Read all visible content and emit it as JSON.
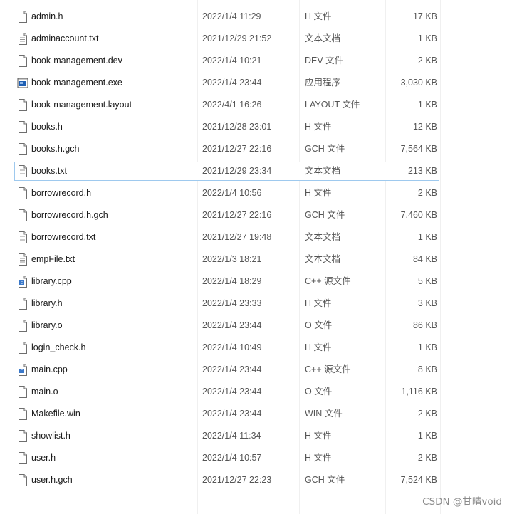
{
  "files": [
    {
      "name": "admin.h",
      "date": "2022/1/4 11:29",
      "type": "H 文件",
      "size": "17 KB",
      "icon": "file-icon"
    },
    {
      "name": "adminaccount.txt",
      "date": "2021/12/29 21:52",
      "type": "文本文档",
      "size": "1 KB",
      "icon": "text-file-icon"
    },
    {
      "name": "book-management.dev",
      "date": "2022/1/4 10:21",
      "type": "DEV 文件",
      "size": "2 KB",
      "icon": "file-icon"
    },
    {
      "name": "book-management.exe",
      "date": "2022/1/4 23:44",
      "type": "应用程序",
      "size": "3,030 KB",
      "icon": "exe-icon"
    },
    {
      "name": "book-management.layout",
      "date": "2022/4/1 16:26",
      "type": "LAYOUT 文件",
      "size": "1 KB",
      "icon": "file-icon"
    },
    {
      "name": "books.h",
      "date": "2021/12/28 23:01",
      "type": "H 文件",
      "size": "12 KB",
      "icon": "file-icon"
    },
    {
      "name": "books.h.gch",
      "date": "2021/12/27 22:16",
      "type": "GCH 文件",
      "size": "7,564 KB",
      "icon": "file-icon"
    },
    {
      "name": "books.txt",
      "date": "2021/12/29 23:34",
      "type": "文本文档",
      "size": "213 KB",
      "icon": "text-file-icon",
      "selected": true
    },
    {
      "name": "borrowrecord.h",
      "date": "2022/1/4 10:56",
      "type": "H 文件",
      "size": "2 KB",
      "icon": "file-icon"
    },
    {
      "name": "borrowrecord.h.gch",
      "date": "2021/12/27 22:16",
      "type": "GCH 文件",
      "size": "7,460 KB",
      "icon": "file-icon"
    },
    {
      "name": "borrowrecord.txt",
      "date": "2021/12/27 19:48",
      "type": "文本文档",
      "size": "1 KB",
      "icon": "text-file-icon"
    },
    {
      "name": "empFile.txt",
      "date": "2022/1/3 18:21",
      "type": "文本文档",
      "size": "84 KB",
      "icon": "text-file-icon"
    },
    {
      "name": "library.cpp",
      "date": "2022/1/4 18:29",
      "type": "C++ 源文件",
      "size": "5 KB",
      "icon": "cpp-file-icon"
    },
    {
      "name": "library.h",
      "date": "2022/1/4 23:33",
      "type": "H 文件",
      "size": "3 KB",
      "icon": "file-icon"
    },
    {
      "name": "library.o",
      "date": "2022/1/4 23:44",
      "type": "O 文件",
      "size": "86 KB",
      "icon": "file-icon"
    },
    {
      "name": "login_check.h",
      "date": "2022/1/4 10:49",
      "type": "H 文件",
      "size": "1 KB",
      "icon": "file-icon"
    },
    {
      "name": "main.cpp",
      "date": "2022/1/4 23:44",
      "type": "C++ 源文件",
      "size": "8 KB",
      "icon": "cpp-file-icon"
    },
    {
      "name": "main.o",
      "date": "2022/1/4 23:44",
      "type": "O 文件",
      "size": "1,116 KB",
      "icon": "file-icon"
    },
    {
      "name": "Makefile.win",
      "date": "2022/1/4 23:44",
      "type": "WIN 文件",
      "size": "2 KB",
      "icon": "file-icon"
    },
    {
      "name": "showlist.h",
      "date": "2022/1/4 11:34",
      "type": "H 文件",
      "size": "1 KB",
      "icon": "file-icon"
    },
    {
      "name": "user.h",
      "date": "2022/1/4 10:57",
      "type": "H 文件",
      "size": "2 KB",
      "icon": "file-icon"
    },
    {
      "name": "user.h.gch",
      "date": "2021/12/27 22:23",
      "type": "GCH 文件",
      "size": "7,524 KB",
      "icon": "file-icon"
    }
  ],
  "watermark": "CSDN @甘晴void",
  "colors": {
    "selection_border": "#9ec9ee",
    "exe_icon_blue": "#1e5fb4",
    "cpp_icon_blue": "#3a78c9"
  }
}
